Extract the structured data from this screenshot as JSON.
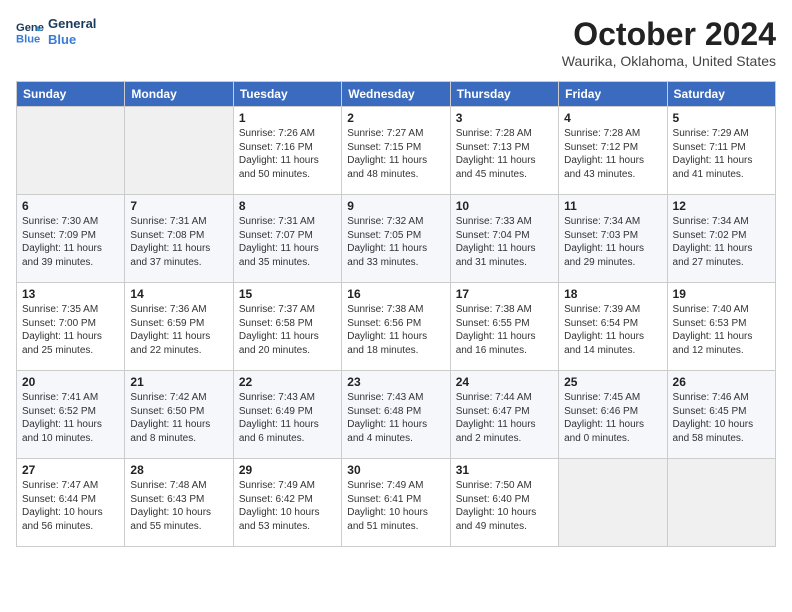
{
  "header": {
    "logo_line1": "General",
    "logo_line2": "Blue",
    "month": "October 2024",
    "location": "Waurika, Oklahoma, United States"
  },
  "days_of_week": [
    "Sunday",
    "Monday",
    "Tuesday",
    "Wednesday",
    "Thursday",
    "Friday",
    "Saturday"
  ],
  "weeks": [
    [
      {
        "num": "",
        "sunrise": "",
        "sunset": "",
        "daylight": ""
      },
      {
        "num": "",
        "sunrise": "",
        "sunset": "",
        "daylight": ""
      },
      {
        "num": "1",
        "sunrise": "Sunrise: 7:26 AM",
        "sunset": "Sunset: 7:16 PM",
        "daylight": "Daylight: 11 hours and 50 minutes."
      },
      {
        "num": "2",
        "sunrise": "Sunrise: 7:27 AM",
        "sunset": "Sunset: 7:15 PM",
        "daylight": "Daylight: 11 hours and 48 minutes."
      },
      {
        "num": "3",
        "sunrise": "Sunrise: 7:28 AM",
        "sunset": "Sunset: 7:13 PM",
        "daylight": "Daylight: 11 hours and 45 minutes."
      },
      {
        "num": "4",
        "sunrise": "Sunrise: 7:28 AM",
        "sunset": "Sunset: 7:12 PM",
        "daylight": "Daylight: 11 hours and 43 minutes."
      },
      {
        "num": "5",
        "sunrise": "Sunrise: 7:29 AM",
        "sunset": "Sunset: 7:11 PM",
        "daylight": "Daylight: 11 hours and 41 minutes."
      }
    ],
    [
      {
        "num": "6",
        "sunrise": "Sunrise: 7:30 AM",
        "sunset": "Sunset: 7:09 PM",
        "daylight": "Daylight: 11 hours and 39 minutes."
      },
      {
        "num": "7",
        "sunrise": "Sunrise: 7:31 AM",
        "sunset": "Sunset: 7:08 PM",
        "daylight": "Daylight: 11 hours and 37 minutes."
      },
      {
        "num": "8",
        "sunrise": "Sunrise: 7:31 AM",
        "sunset": "Sunset: 7:07 PM",
        "daylight": "Daylight: 11 hours and 35 minutes."
      },
      {
        "num": "9",
        "sunrise": "Sunrise: 7:32 AM",
        "sunset": "Sunset: 7:05 PM",
        "daylight": "Daylight: 11 hours and 33 minutes."
      },
      {
        "num": "10",
        "sunrise": "Sunrise: 7:33 AM",
        "sunset": "Sunset: 7:04 PM",
        "daylight": "Daylight: 11 hours and 31 minutes."
      },
      {
        "num": "11",
        "sunrise": "Sunrise: 7:34 AM",
        "sunset": "Sunset: 7:03 PM",
        "daylight": "Daylight: 11 hours and 29 minutes."
      },
      {
        "num": "12",
        "sunrise": "Sunrise: 7:34 AM",
        "sunset": "Sunset: 7:02 PM",
        "daylight": "Daylight: 11 hours and 27 minutes."
      }
    ],
    [
      {
        "num": "13",
        "sunrise": "Sunrise: 7:35 AM",
        "sunset": "Sunset: 7:00 PM",
        "daylight": "Daylight: 11 hours and 25 minutes."
      },
      {
        "num": "14",
        "sunrise": "Sunrise: 7:36 AM",
        "sunset": "Sunset: 6:59 PM",
        "daylight": "Daylight: 11 hours and 22 minutes."
      },
      {
        "num": "15",
        "sunrise": "Sunrise: 7:37 AM",
        "sunset": "Sunset: 6:58 PM",
        "daylight": "Daylight: 11 hours and 20 minutes."
      },
      {
        "num": "16",
        "sunrise": "Sunrise: 7:38 AM",
        "sunset": "Sunset: 6:56 PM",
        "daylight": "Daylight: 11 hours and 18 minutes."
      },
      {
        "num": "17",
        "sunrise": "Sunrise: 7:38 AM",
        "sunset": "Sunset: 6:55 PM",
        "daylight": "Daylight: 11 hours and 16 minutes."
      },
      {
        "num": "18",
        "sunrise": "Sunrise: 7:39 AM",
        "sunset": "Sunset: 6:54 PM",
        "daylight": "Daylight: 11 hours and 14 minutes."
      },
      {
        "num": "19",
        "sunrise": "Sunrise: 7:40 AM",
        "sunset": "Sunset: 6:53 PM",
        "daylight": "Daylight: 11 hours and 12 minutes."
      }
    ],
    [
      {
        "num": "20",
        "sunrise": "Sunrise: 7:41 AM",
        "sunset": "Sunset: 6:52 PM",
        "daylight": "Daylight: 11 hours and 10 minutes."
      },
      {
        "num": "21",
        "sunrise": "Sunrise: 7:42 AM",
        "sunset": "Sunset: 6:50 PM",
        "daylight": "Daylight: 11 hours and 8 minutes."
      },
      {
        "num": "22",
        "sunrise": "Sunrise: 7:43 AM",
        "sunset": "Sunset: 6:49 PM",
        "daylight": "Daylight: 11 hours and 6 minutes."
      },
      {
        "num": "23",
        "sunrise": "Sunrise: 7:43 AM",
        "sunset": "Sunset: 6:48 PM",
        "daylight": "Daylight: 11 hours and 4 minutes."
      },
      {
        "num": "24",
        "sunrise": "Sunrise: 7:44 AM",
        "sunset": "Sunset: 6:47 PM",
        "daylight": "Daylight: 11 hours and 2 minutes."
      },
      {
        "num": "25",
        "sunrise": "Sunrise: 7:45 AM",
        "sunset": "Sunset: 6:46 PM",
        "daylight": "Daylight: 11 hours and 0 minutes."
      },
      {
        "num": "26",
        "sunrise": "Sunrise: 7:46 AM",
        "sunset": "Sunset: 6:45 PM",
        "daylight": "Daylight: 10 hours and 58 minutes."
      }
    ],
    [
      {
        "num": "27",
        "sunrise": "Sunrise: 7:47 AM",
        "sunset": "Sunset: 6:44 PM",
        "daylight": "Daylight: 10 hours and 56 minutes."
      },
      {
        "num": "28",
        "sunrise": "Sunrise: 7:48 AM",
        "sunset": "Sunset: 6:43 PM",
        "daylight": "Daylight: 10 hours and 55 minutes."
      },
      {
        "num": "29",
        "sunrise": "Sunrise: 7:49 AM",
        "sunset": "Sunset: 6:42 PM",
        "daylight": "Daylight: 10 hours and 53 minutes."
      },
      {
        "num": "30",
        "sunrise": "Sunrise: 7:49 AM",
        "sunset": "Sunset: 6:41 PM",
        "daylight": "Daylight: 10 hours and 51 minutes."
      },
      {
        "num": "31",
        "sunrise": "Sunrise: 7:50 AM",
        "sunset": "Sunset: 6:40 PM",
        "daylight": "Daylight: 10 hours and 49 minutes."
      },
      {
        "num": "",
        "sunrise": "",
        "sunset": "",
        "daylight": ""
      },
      {
        "num": "",
        "sunrise": "",
        "sunset": "",
        "daylight": ""
      }
    ]
  ]
}
